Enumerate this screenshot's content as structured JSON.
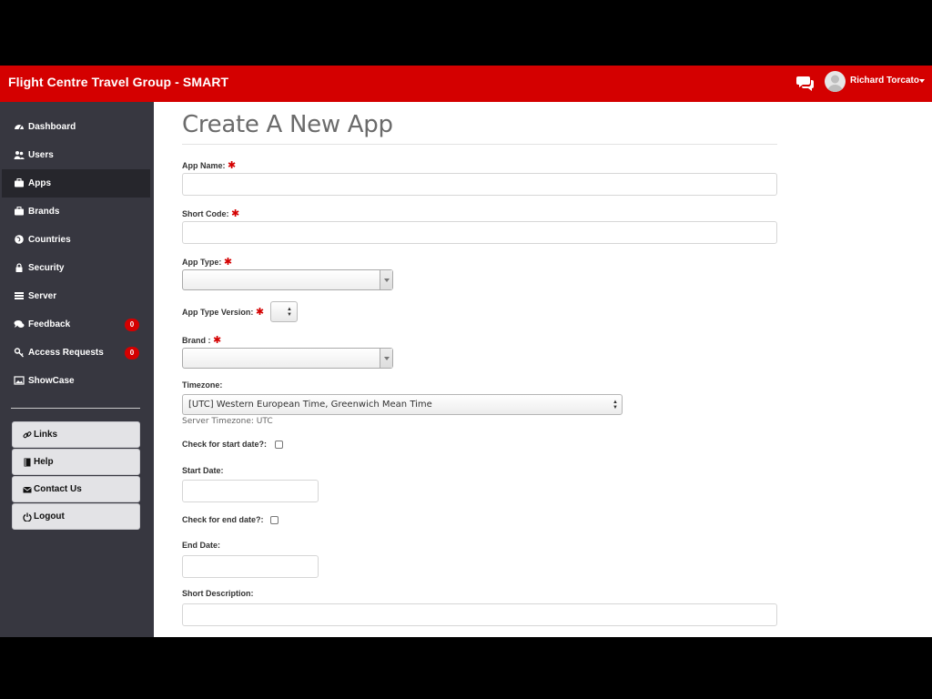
{
  "header": {
    "brand": "Flight Centre Travel Group - SMART",
    "user_name": "Richard Torcato",
    "icons": {
      "chat": "chat-bubbles-icon",
      "avatar": "user-avatar",
      "caret": "caret-down-icon"
    }
  },
  "sidebar": {
    "items": [
      {
        "label": "Dashboard",
        "icon": "dashboard-icon"
      },
      {
        "label": "Users",
        "icon": "users-icon"
      },
      {
        "label": "Apps",
        "icon": "briefcase-icon",
        "active": true
      },
      {
        "label": "Brands",
        "icon": "briefcase-icon"
      },
      {
        "label": "Countries",
        "icon": "globe-icon"
      },
      {
        "label": "Security",
        "icon": "lock-icon"
      },
      {
        "label": "Server",
        "icon": "server-icon"
      },
      {
        "label": "Feedback",
        "icon": "comments-icon",
        "badge": "0"
      },
      {
        "label": "Access Requests",
        "icon": "key-icon",
        "badge": "0"
      },
      {
        "label": "ShowCase",
        "icon": "picture-icon"
      }
    ],
    "buttons": [
      {
        "label": "Links",
        "icon": "link-icon"
      },
      {
        "label": "Help",
        "icon": "book-icon"
      },
      {
        "label": "Contact Us",
        "icon": "envelope-icon"
      },
      {
        "label": "Logout",
        "icon": "power-icon"
      }
    ]
  },
  "form": {
    "title": "Create A New App",
    "required_marker": "✱",
    "app_name": {
      "label": "App Name:",
      "value": ""
    },
    "short_code": {
      "label": "Short Code:",
      "value": ""
    },
    "app_type": {
      "label": "App Type:",
      "value": ""
    },
    "app_type_version": {
      "label": "App Type Version:",
      "value": ""
    },
    "brand": {
      "label": "Brand :",
      "value": ""
    },
    "timezone": {
      "label": "Timezone:",
      "value": "[UTC] Western European Time, Greenwich Mean Time",
      "hint": "Server Timezone: UTC"
    },
    "check_start": {
      "label": "Check for start date?:",
      "checked": false
    },
    "start_date": {
      "label": "Start Date:",
      "value": ""
    },
    "check_end": {
      "label": "Check for end date?:",
      "checked": false
    },
    "end_date": {
      "label": "End Date:",
      "value": ""
    },
    "short_description": {
      "label": "Short Description:",
      "value": ""
    }
  },
  "colors": {
    "header": "#d40000",
    "sidebar": "#373740",
    "sidebar_active": "#26262c",
    "badge": "#d40000",
    "required": "#d40000"
  }
}
